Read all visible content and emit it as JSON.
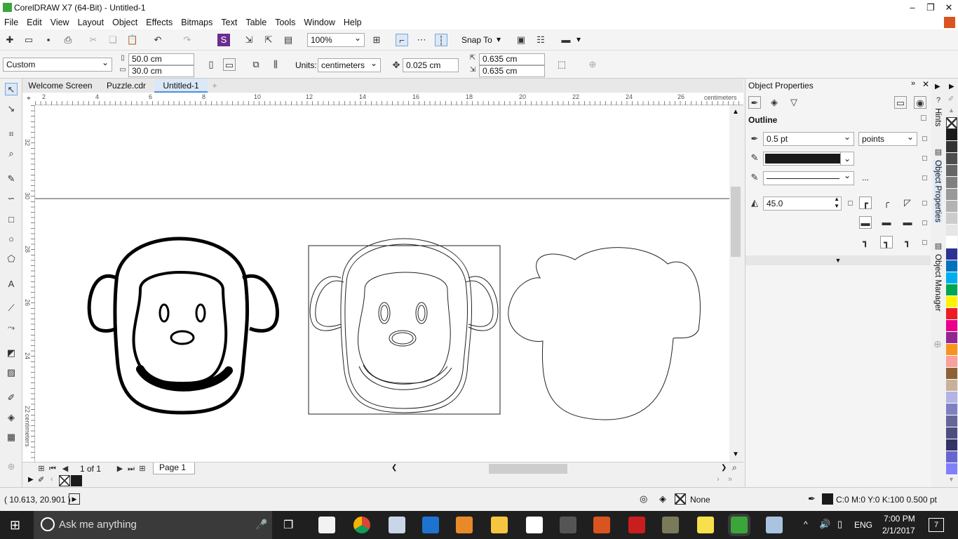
{
  "window": {
    "title": "CorelDRAW X7 (64-Bit) - Untitled-1"
  },
  "menu": [
    "File",
    "Edit",
    "View",
    "Layout",
    "Object",
    "Effects",
    "Bitmaps",
    "Text",
    "Table",
    "Tools",
    "Window",
    "Help"
  ],
  "toolbar": {
    "zoom": "100%",
    "snap_to": "Snap To"
  },
  "propbar": {
    "preset": "Custom",
    "width": "50.0 cm",
    "height": "30.0 cm",
    "units_label": "Units:",
    "units": "centimeters",
    "nudge": "0.025 cm",
    "dup_x": "0.635 cm",
    "dup_y": "0.635 cm"
  },
  "tabs": [
    {
      "label": "Welcome Screen",
      "active": false
    },
    {
      "label": "Puzzle.cdr",
      "active": false
    },
    {
      "label": "Untitled-1",
      "active": true
    }
  ],
  "ruler": {
    "unit": "centimeters",
    "h_ticks": [
      "2",
      "4",
      "6",
      "8",
      "10",
      "12",
      "14",
      "16",
      "18",
      "20",
      "22",
      "24",
      "26"
    ],
    "v_ticks": [
      "32",
      "30",
      "28",
      "26",
      "24",
      "22"
    ]
  },
  "pager": {
    "count": "1 of 1",
    "page": "Page 1"
  },
  "docker": {
    "title": "Object Properties",
    "section": "Outline",
    "width": "0.5 pt",
    "units": "points",
    "miter": "45.0",
    "ellipsis": "..."
  },
  "docker_tabs": [
    "Hints",
    "Object Properties",
    "Object Manager"
  ],
  "palette": [
    "#ffffff",
    "#1a1a1a",
    "#333333",
    "#4d4d4d",
    "#666666",
    "#808080",
    "#999999",
    "#b3b3b3",
    "#cccccc",
    "#e6e6e6",
    "#ffffff",
    "#2e3192",
    "#0072bc",
    "#00aeef",
    "#00a651",
    "#fff200",
    "#ed1c24",
    "#ec008c",
    "#92278f",
    "#f7941d",
    "#f9a19a",
    "#8c6239",
    "#c7b299",
    "#b3b3e6",
    "#8080c0",
    "#666699",
    "#4d4d80",
    "#333366",
    "#6666cc",
    "#8080ff",
    "#555577",
    "#3a3a5a"
  ],
  "status": {
    "coords": "( 10.613, 20.901 )",
    "fill": "None",
    "outline": "C:0 M:0 Y:0 K:100  0.500 pt"
  },
  "taskbar": {
    "search": "Ask me anything",
    "lang": "ENG",
    "time": "7:00 PM",
    "date": "2/1/2017",
    "notif": "7"
  }
}
